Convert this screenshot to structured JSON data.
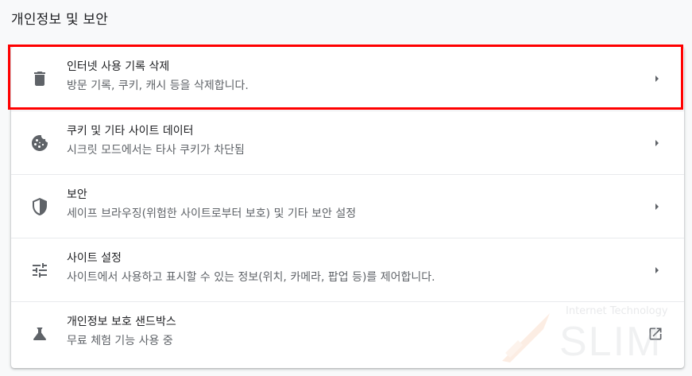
{
  "section_title": "개인정보 및 보안",
  "rows": [
    {
      "label": "인터넷 사용 기록 삭제",
      "sub": "방문 기록, 쿠키, 캐시 등을 삭제합니다.",
      "icon": "trash-icon",
      "action": "chevron-right-icon"
    },
    {
      "label": "쿠키 및 기타 사이트 데이터",
      "sub": "시크릿 모드에서는 타사 쿠키가 차단됨",
      "icon": "cookie-icon",
      "action": "chevron-right-icon"
    },
    {
      "label": "보안",
      "sub": "세이프 브라우징(위험한 사이트로부터 보호) 및 기타 보안 설정",
      "icon": "shield-icon",
      "action": "chevron-right-icon"
    },
    {
      "label": "사이트 설정",
      "sub": "사이트에서 사용하고 표시할 수 있는 정보(위치, 카메라, 팝업 등)를 제어합니다.",
      "icon": "sliders-icon",
      "action": "chevron-right-icon"
    },
    {
      "label": "개인정보 보호 샌드박스",
      "sub": "무료 체험 기능 사용 중",
      "icon": "flask-icon",
      "action": "open-external-icon"
    }
  ],
  "watermark": {
    "top_text": "Internet Technology",
    "main_text": "SLIM"
  },
  "colors": {
    "highlight": "#ff0000",
    "icon": "#5f6368",
    "text_primary": "#202124",
    "text_secondary": "#5f6368"
  }
}
